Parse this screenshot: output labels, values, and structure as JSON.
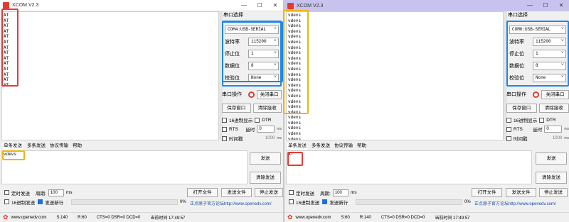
{
  "windows": [
    {
      "title": "XCOM V2.3",
      "recv_lines": [
        "AT",
        "AT",
        "AT",
        "AT",
        "AT",
        "AT",
        "AT",
        "AT",
        "AT",
        "AT",
        "AT",
        "AT",
        "AT",
        "AT"
      ],
      "port_label": "串口选择",
      "port_value": "COM4:USB-SERIAL",
      "baud_label": "波特率",
      "baud_value": "115200",
      "stop_label": "停止位",
      "stop_value": "1",
      "data_label": "数据位",
      "data_value": "8",
      "parity_label": "校验位",
      "parity_value": "None",
      "op_label": "串口操作",
      "op_button": "关闭串口",
      "save_button": "保存窗口",
      "clear_recv_button": "清除接收",
      "hex_display": "16进制显示",
      "dtr": "DTR",
      "rts": "RTS",
      "delay_label": "延时",
      "delay_value": "0",
      "delay_unit": "ms",
      "timestamp_label": "时间戳",
      "timestamp_value": "1000",
      "timestamp_unit": "ms",
      "tabs": [
        "单条发送",
        "多条发送",
        "协议传输",
        "帮助"
      ],
      "send_text": "vdevs",
      "send_button": "发送",
      "clear_send_button": "清除发送",
      "timed_send": "定时发送",
      "period_label": "周期:",
      "period_value": "100",
      "period_unit": "ms",
      "hex_send": "16进制发送",
      "newline": "发送新行",
      "open_file": "打开文件",
      "send_file": "发送文件",
      "stop_send": "停止发送",
      "progress_pct": "0%",
      "forum_link": "正点原子官方论坛http://www.openedv.com/",
      "site": "www.openedv.com",
      "s_count": "S:140",
      "r_count": "R:60",
      "lines_status": "CTS=0 DSR=0 DCD=0",
      "time": "当前时间 17:49:57"
    },
    {
      "title": "XCOM V2.3",
      "recv_lines": [
        "vdevs",
        "vdevs",
        "vdevs",
        "vdevs",
        "vdevs",
        "vdevs",
        "vdevs",
        "vdevs",
        "vdevs",
        "vdevs",
        "vdevs",
        "vdevs",
        "vdevs",
        "vdevs",
        "vdevs",
        "vdevs",
        "vdevs",
        "vdevs",
        "vdevs",
        "vdevs",
        "vdevs",
        "vdevs",
        "vdevs",
        "vdevs",
        "vdevs",
        "vdevs",
        "vdevs",
        "vdevs"
      ],
      "port_label": "串口选择",
      "port_value": "COM0:USB-SERIAL",
      "baud_label": "波特率",
      "baud_value": "115200",
      "stop_label": "停止位",
      "stop_value": "1",
      "data_label": "数据位",
      "data_value": "8",
      "parity_label": "校验位",
      "parity_value": "None",
      "op_label": "串口操作",
      "op_button": "关闭串口",
      "save_button": "保存窗口",
      "clear_recv_button": "清除接收",
      "hex_display": "16进制显示",
      "dtr": "DTR",
      "rts": "RTS",
      "delay_label": "延时",
      "delay_value": "0",
      "delay_unit": "ms",
      "timestamp_label": "时间戳",
      "timestamp_value": "1000",
      "timestamp_unit": "ms",
      "tabs": [
        "单条发送",
        "多条发送",
        "协议传输",
        "帮助"
      ],
      "send_text": "AT",
      "send_button": "发送",
      "clear_send_button": "清除发送",
      "timed_send": "定时发送",
      "period_label": "周期:",
      "period_value": "100",
      "period_unit": "ms",
      "hex_send": "16进制发送",
      "newline": "发送新行",
      "open_file": "打开文件",
      "send_file": "发送文件",
      "stop_send": "停止发送",
      "progress_pct": "0%",
      "forum_link": "正点原子官方论坛http://www.openedv.com/",
      "site": "www.openedv.com",
      "s_count": "S:60",
      "r_count": "R:140",
      "lines_status": "CTS=0 DSR=0 DCD=0",
      "time": "当前时间 17:49:57"
    }
  ],
  "colors": {
    "highlight_red": "#e53935",
    "highlight_yellow": "#f5b400",
    "highlight_blue": "#1e88e5"
  }
}
